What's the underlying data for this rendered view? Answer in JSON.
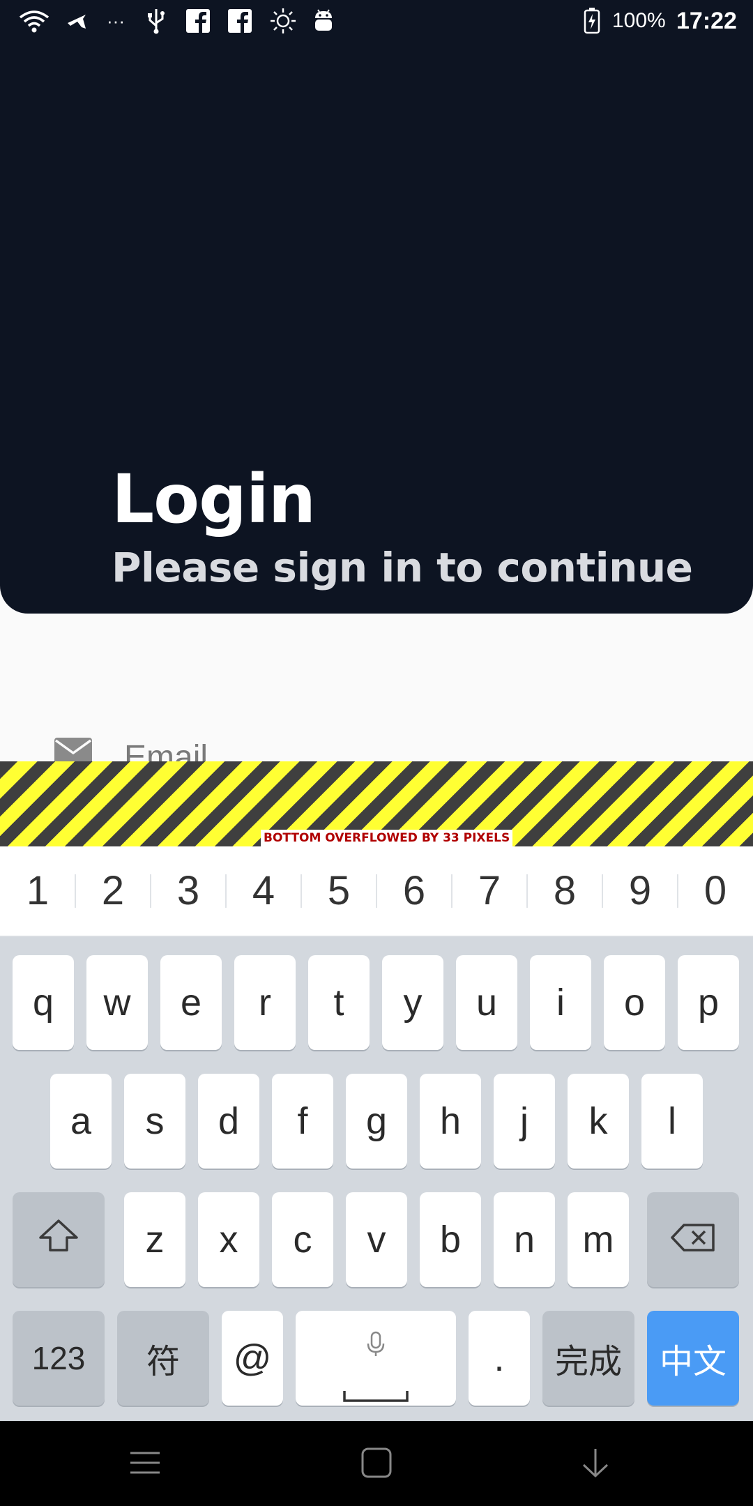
{
  "status_bar": {
    "battery_percent": "100%",
    "time": "17:22",
    "icons": [
      "wifi-icon",
      "airplane-icon",
      "more-icon",
      "usb-icon",
      "facebook-icon",
      "facebook-icon",
      "brightness-icon",
      "android-icon",
      "battery-charging-icon"
    ]
  },
  "header": {
    "title": "Login",
    "subtitle": "Please sign in to continue"
  },
  "email": {
    "placeholder": "Email",
    "icon": "mail-icon"
  },
  "overflow_banner": {
    "label": "BOTTOM OVERFLOWED BY 33 PIXELS"
  },
  "keyboard": {
    "number_row": [
      "1",
      "2",
      "3",
      "4",
      "5",
      "6",
      "7",
      "8",
      "9",
      "0"
    ],
    "row1": [
      "q",
      "w",
      "e",
      "r",
      "t",
      "y",
      "u",
      "i",
      "o",
      "p"
    ],
    "row2": [
      "a",
      "s",
      "d",
      "f",
      "g",
      "h",
      "j",
      "k",
      "l"
    ],
    "row3": [
      "z",
      "x",
      "c",
      "v",
      "b",
      "n",
      "m"
    ],
    "bottom": {
      "numbers": "123",
      "symbols": "符",
      "at": "@",
      "period": ".",
      "done": "完成",
      "chinese": "中文"
    }
  },
  "colors": {
    "header_bg": "#0d1422",
    "chinese_key": "#4a9bf5",
    "overflow_yellow": "#ffff33"
  }
}
